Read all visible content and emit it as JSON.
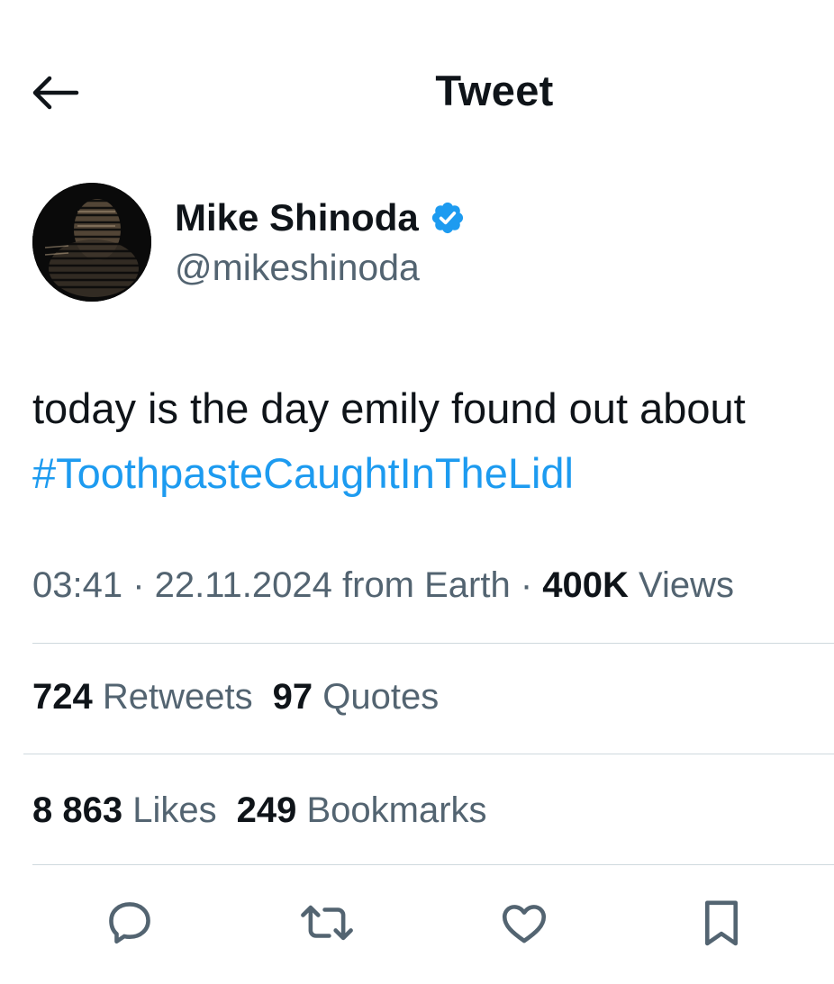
{
  "header": {
    "title": "Tweet"
  },
  "author": {
    "name": "Mike Shinoda",
    "handle": "@mikeshinoda"
  },
  "tweet": {
    "text": "today is the day emily found out about",
    "hashtag": "#ToothpasteCaughtInTheLidl"
  },
  "meta": {
    "time": "03:41",
    "sep1": " · ",
    "date": "22.11.2024",
    "source": " from Earth",
    "sep2": " · ",
    "views_count": "400K",
    "views_label": " Views"
  },
  "stats": {
    "retweets": {
      "count": "724",
      "label": " Retweets"
    },
    "quotes": {
      "count": "97",
      "label": " Quotes"
    },
    "likes": {
      "count": "8 863",
      "label": " Likes"
    },
    "bookmarks": {
      "count": "249",
      "label": " Bookmarks"
    }
  },
  "icons": {
    "back": "arrow-left-icon",
    "verified": "verified-badge-icon",
    "reply": "reply-icon",
    "retweet": "retweet-icon",
    "like": "heart-icon",
    "bookmark": "bookmark-icon"
  },
  "colors": {
    "accent": "#1d9bf0",
    "text": "#0f1419",
    "secondary": "#536471",
    "divider": "#cfd9de"
  }
}
